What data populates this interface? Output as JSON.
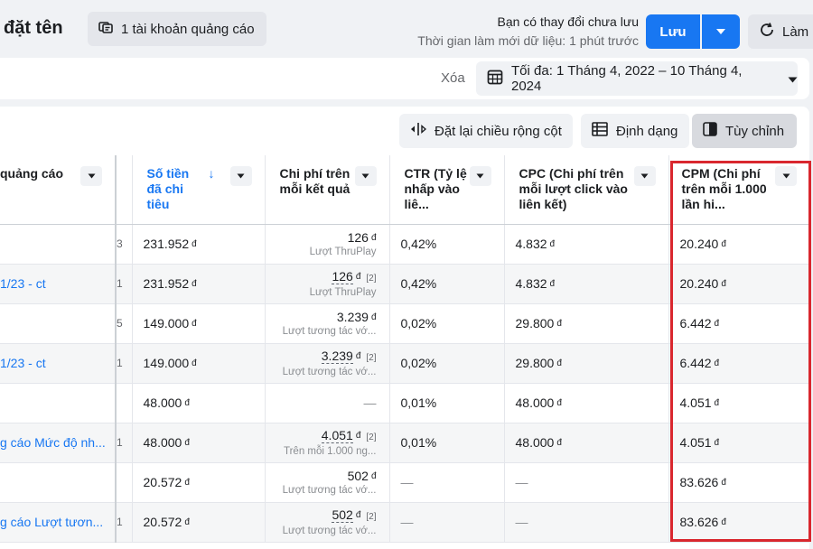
{
  "header": {
    "title": "đặt tên",
    "account_button": "1 tài khoản quảng cáo",
    "unsaved_text": "Bạn có thay đổi chưa lưu",
    "refresh_time_text": "Thời gian làm mới dữ liệu: 1 phút trước",
    "save_label": "Lưu",
    "refresh_label": "Làm m"
  },
  "filter_bar": {
    "clear_label": "Xóa",
    "date_range": "Tối đa: 1 Tháng 4, 2022 – 10 Tháng 4, 2024"
  },
  "toolbar": {
    "reset_width_label": "Đặt lại chiều rộng cột",
    "format_label": "Định dạng",
    "customize_label": "Tùy chỉnh"
  },
  "table": {
    "columns": [
      {
        "label": "quảng cáo"
      },
      {
        "label": ""
      },
      {
        "label": "Số tiền đã chi tiêu"
      },
      {
        "label": "Chi phí trên mỗi kết quả"
      },
      {
        "label": "CTR (Tỷ lệ nhấp vào liê..."
      },
      {
        "label": "CPC (Chi phí trên mỗi lượt click vào liên kết)"
      },
      {
        "label": "CPM (Chi phí trên mỗi 1.000 lần hi..."
      }
    ],
    "currency": "đ",
    "footnote": "[2]",
    "rows": [
      {
        "name": "",
        "edge": "3",
        "spent": "231.952",
        "cpr": "126",
        "cpr_sub": "Lượt ThruPlay",
        "cpr_note": "",
        "ctr": "0,42%",
        "cpc": "4.832",
        "cpm": "20.240"
      },
      {
        "name": "1/23 - ct",
        "edge": "1",
        "spent": "231.952",
        "cpr": "126",
        "cpr_sub": "Lượt ThruPlay",
        "cpr_note": "[2]",
        "ctr": "0,42%",
        "cpc": "4.832",
        "cpm": "20.240"
      },
      {
        "name": "",
        "edge": "5",
        "spent": "149.000",
        "cpr": "3.239",
        "cpr_sub": "Lượt tương tác vớ...",
        "cpr_note": "",
        "ctr": "0,02%",
        "cpc": "29.800",
        "cpm": "6.442"
      },
      {
        "name": "1/23 - ct",
        "edge": "1",
        "spent": "149.000",
        "cpr": "3.239",
        "cpr_sub": "Lượt tương tác vớ...",
        "cpr_note": "[2]",
        "ctr": "0,02%",
        "cpc": "29.800",
        "cpm": "6.442"
      },
      {
        "name": "",
        "edge": "",
        "spent": "48.000",
        "cpr": "—",
        "cpr_sub": "",
        "cpr_note": "",
        "ctr": "0,01%",
        "cpc": "48.000",
        "cpm": "4.051"
      },
      {
        "name": "g cáo Mức độ nh...",
        "edge": "1",
        "spent": "48.000",
        "cpr": "4.051",
        "cpr_sub": "Trên mỗi 1.000 ng...",
        "cpr_note": "[2]",
        "ctr": "0,01%",
        "cpc": "48.000",
        "cpm": "4.051"
      },
      {
        "name": "",
        "edge": "",
        "spent": "20.572",
        "cpr": "502",
        "cpr_sub": "Lượt tương tác vớ...",
        "cpr_note": "",
        "ctr": "—",
        "cpc": "—",
        "cpm": "83.626"
      },
      {
        "name": "g cáo Lượt tươn...",
        "edge": "1",
        "spent": "20.572",
        "cpr": "502",
        "cpr_sub": "Lượt tương tác vớ...",
        "cpr_note": "[2]",
        "ctr": "—",
        "cpc": "—",
        "cpm": "83.626"
      }
    ]
  },
  "colors": {
    "accent": "#1877f2",
    "highlight": "#d9272e"
  }
}
